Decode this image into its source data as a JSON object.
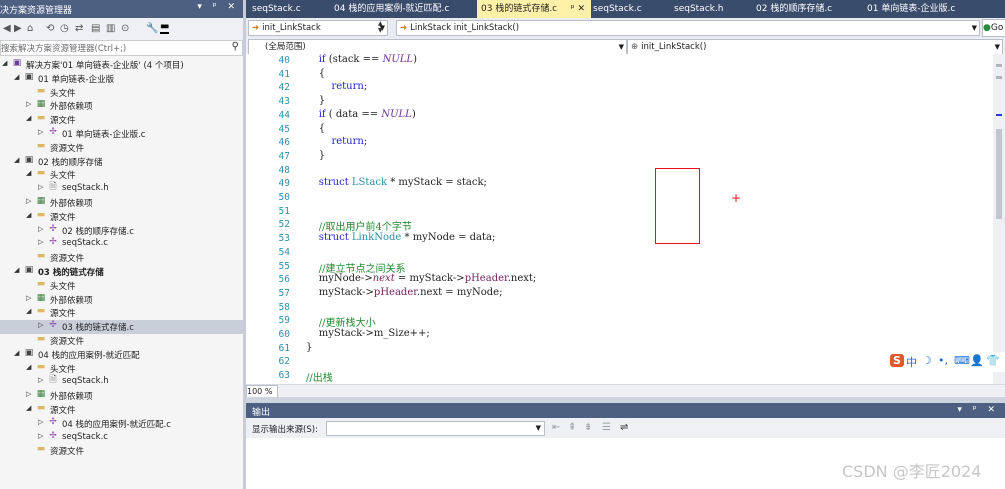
{
  "solution_explorer": {
    "title": "决方案资源管理器",
    "title_buttons": "▾ ᵖ ✕",
    "search_placeholder": "搜索解决方案资源管理器(Ctrl+;)",
    "search_icon": "search-icon",
    "tree": [
      {
        "indent": 0,
        "arrow": "◢",
        "icon": "solution-icon",
        "glyph": "▣",
        "label": "解决方案'01 单向链表-企业版' (4 个项目)",
        "bold": false
      },
      {
        "indent": 1,
        "arrow": "◢",
        "icon": "project-icon",
        "glyph": "▣",
        "label": "01 单向链表-企业版",
        "bold": false
      },
      {
        "indent": 2,
        "arrow": "",
        "icon": "folder-icon",
        "glyph": "▬",
        "label": "头文件",
        "bold": false
      },
      {
        "indent": 2,
        "arrow": "▷",
        "icon": "references-icon",
        "glyph": "▦",
        "label": "外部依赖项",
        "bold": false
      },
      {
        "indent": 2,
        "arrow": "◢",
        "icon": "folder-icon",
        "glyph": "▬",
        "label": "源文件",
        "bold": false
      },
      {
        "indent": 3,
        "arrow": "▷",
        "icon": "c-file-icon",
        "glyph": "✢",
        "label": "01 单向链表-企业版.c",
        "bold": false
      },
      {
        "indent": 2,
        "arrow": "",
        "icon": "folder-icon",
        "glyph": "▬",
        "label": "资源文件",
        "bold": false
      },
      {
        "indent": 1,
        "arrow": "◢",
        "icon": "project-icon",
        "glyph": "▣",
        "label": "02 栈的顺序存储",
        "bold": false
      },
      {
        "indent": 2,
        "arrow": "◢",
        "icon": "folder-icon",
        "glyph": "▬",
        "label": "头文件",
        "bold": false
      },
      {
        "indent": 3,
        "arrow": "▷",
        "icon": "h-file-icon",
        "glyph": "🗎",
        "label": "seqStack.h",
        "bold": false
      },
      {
        "indent": 2,
        "arrow": "▷",
        "icon": "references-icon",
        "glyph": "▦",
        "label": "外部依赖项",
        "bold": false
      },
      {
        "indent": 2,
        "arrow": "◢",
        "icon": "folder-icon",
        "glyph": "▬",
        "label": "源文件",
        "bold": false
      },
      {
        "indent": 3,
        "arrow": "▷",
        "icon": "c-file-icon",
        "glyph": "✢",
        "label": "02 栈的顺序存储.c",
        "bold": false
      },
      {
        "indent": 3,
        "arrow": "▷",
        "icon": "c-file-icon",
        "glyph": "✢",
        "label": "seqStack.c",
        "bold": false
      },
      {
        "indent": 2,
        "arrow": "",
        "icon": "folder-icon",
        "glyph": "▬",
        "label": "资源文件",
        "bold": false
      },
      {
        "indent": 1,
        "arrow": "◢",
        "icon": "project-icon",
        "glyph": "▣",
        "label": "03 栈的链式存储",
        "bold": true
      },
      {
        "indent": 2,
        "arrow": "",
        "icon": "folder-icon",
        "glyph": "▬",
        "label": "头文件",
        "bold": false
      },
      {
        "indent": 2,
        "arrow": "▷",
        "icon": "references-icon",
        "glyph": "▦",
        "label": "外部依赖项",
        "bold": false
      },
      {
        "indent": 2,
        "arrow": "◢",
        "icon": "folder-icon",
        "glyph": "▬",
        "label": "源文件",
        "bold": false
      },
      {
        "indent": 3,
        "arrow": "▷",
        "icon": "c-file-icon",
        "glyph": "✢",
        "label": "03 栈的链式存储.c",
        "bold": false,
        "selected": true
      },
      {
        "indent": 2,
        "arrow": "",
        "icon": "folder-icon",
        "glyph": "▬",
        "label": "资源文件",
        "bold": false
      },
      {
        "indent": 1,
        "arrow": "◢",
        "icon": "project-icon",
        "glyph": "▣",
        "label": "04 栈的应用案例-就近匹配",
        "bold": false
      },
      {
        "indent": 2,
        "arrow": "◢",
        "icon": "folder-icon",
        "glyph": "▬",
        "label": "头文件",
        "bold": false
      },
      {
        "indent": 3,
        "arrow": "▷",
        "icon": "h-file-icon",
        "glyph": "🗎",
        "label": "seqStack.h",
        "bold": false
      },
      {
        "indent": 2,
        "arrow": "▷",
        "icon": "references-icon",
        "glyph": "▦",
        "label": "外部依赖项",
        "bold": false
      },
      {
        "indent": 2,
        "arrow": "◢",
        "icon": "folder-icon",
        "glyph": "▬",
        "label": "源文件",
        "bold": false
      },
      {
        "indent": 3,
        "arrow": "▷",
        "icon": "c-file-icon",
        "glyph": "✢",
        "label": "04 栈的应用案例-就近匹配.c",
        "bold": false
      },
      {
        "indent": 3,
        "arrow": "▷",
        "icon": "c-file-icon",
        "glyph": "✢",
        "label": "seqStack.c",
        "bold": false
      },
      {
        "indent": 2,
        "arrow": "",
        "icon": "folder-icon",
        "glyph": "▬",
        "label": "资源文件",
        "bold": false
      }
    ]
  },
  "tabs": [
    {
      "label": "seqStack.c",
      "active": false
    },
    {
      "label": "04 栈的应用案例-就近匹配.c",
      "active": false
    },
    {
      "label": "03 栈的链式存储.c",
      "active": true,
      "close": "ᵖ ✕"
    },
    {
      "label": "seqStack.c",
      "active": false
    },
    {
      "label": "seqStack.h",
      "active": false
    },
    {
      "label": "02 栈的顺序存储.c",
      "active": false
    },
    {
      "label": "01 单向链表-企业版.c",
      "active": false
    }
  ],
  "nav": {
    "scope_combo": "init_LinkStack",
    "function_combo": "LinkStack init_LinkStack()",
    "go_button": "Go",
    "global_scope": "(全局范围)",
    "member_combo": "init_LinkStack()"
  },
  "editor": {
    "lines": [
      {
        "n": "40",
        "fold": "",
        "html": "    <span class=\"kw\">if</span> (stack == <span class=\"mac\">NULL</span>)"
      },
      {
        "n": "41",
        "fold": "",
        "html": "    {"
      },
      {
        "n": "42",
        "fold": "",
        "html": "        <span class=\"kw\">return</span>;"
      },
      {
        "n": "43",
        "fold": "",
        "html": "    }"
      },
      {
        "n": "44",
        "fold": "",
        "html": "    <span class=\"kw\">if</span> ( data == <span class=\"mac\">NULL</span>)"
      },
      {
        "n": "45",
        "fold": "",
        "html": "    {"
      },
      {
        "n": "46",
        "fold": "",
        "html": "        <span class=\"kw\">return</span>;"
      },
      {
        "n": "47",
        "fold": "",
        "html": "    }"
      },
      {
        "n": "48",
        "fold": "",
        "html": ""
      },
      {
        "n": "49",
        "fold": "",
        "html": "    <span class=\"kw\">struct</span> <span class=\"ty\">LStack</span> * myStack = stack;"
      },
      {
        "n": "50",
        "fold": "",
        "html": ""
      },
      {
        "n": "51",
        "fold": "",
        "html": ""
      },
      {
        "n": "52",
        "fold": "",
        "html": "    <span class=\"cm\">//取出用户前4个字节</span>"
      },
      {
        "n": "53",
        "fold": "",
        "html": "    <span class=\"kw\">struct</span> <span class=\"ty\">LinkNode</span> * myNode = data;"
      },
      {
        "n": "54",
        "fold": "",
        "html": ""
      },
      {
        "n": "55",
        "fold": "",
        "html": "    <span class=\"cm\">//建立节点之间关系</span>"
      },
      {
        "n": "56",
        "fold": "",
        "html": "    myNode-><span class=\"itl\">next</span> = myStack-><span class=\"mem\">pHeader</span>.next;"
      },
      {
        "n": "57",
        "fold": "",
        "html": "    myStack-><span class=\"mem\">pHeader</span>.next = myNode;"
      },
      {
        "n": "58",
        "fold": "",
        "html": ""
      },
      {
        "n": "59",
        "fold": "",
        "html": "    <span class=\"cm\">//更新栈大小</span>"
      },
      {
        "n": "60",
        "fold": "",
        "html": "    myStack->m_Size++;"
      },
      {
        "n": "61",
        "fold": "",
        "html": "}"
      },
      {
        "n": "62",
        "fold": "",
        "html": ""
      },
      {
        "n": "63",
        "fold": "",
        "html": "<span class=\"cm\">//出栈</span>"
      }
    ],
    "zoom": "100 %"
  },
  "ime_bar": {
    "glyphs": [
      "S",
      "中",
      "☽",
      "•,",
      "⌨",
      "👤",
      "👕"
    ]
  },
  "output": {
    "title": "输出",
    "title_buttons": "▾ ᵖ ✕",
    "show_from_label": "显示输出来源(S):",
    "source_value": ""
  },
  "watermark": "CSDN @李匠2024",
  "colors": {
    "accent": "#4d6082",
    "tab_active": "#fff1a8",
    "tab_bar": "#3a4c6b",
    "keyword": "#1f1fcf",
    "comment": "#1f8a2e",
    "line_number": "#2b91af",
    "annotation": "#e11111"
  }
}
